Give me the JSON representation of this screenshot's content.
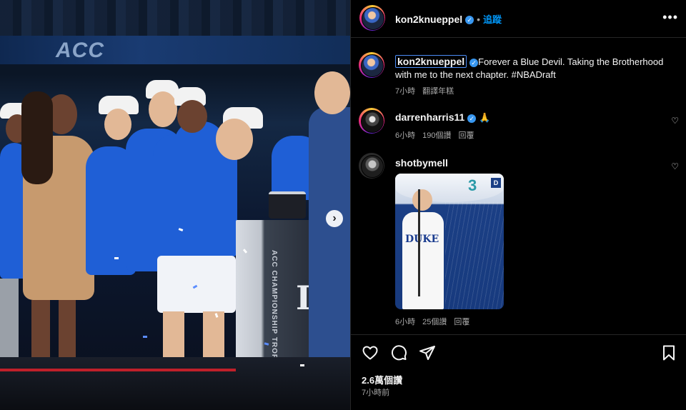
{
  "photo": {
    "banner_text": "ACC",
    "podium_text": "ACC CHAMPIONSHIP TROPHY",
    "podium_letter": "D",
    "next_arrow": "›"
  },
  "header": {
    "username": "kon2knueppel",
    "follow_label": "追蹤",
    "more_label": "•••"
  },
  "caption": {
    "username": "kon2knueppel",
    "text": "Forever a Blue Devil. Taking the Brotherhood with me to the next chapter. #NBADraft",
    "time": "7小時",
    "translate": "翻譯年糕"
  },
  "comments": [
    {
      "username": "darrenharris11",
      "text": "🙏",
      "time": "6小時",
      "likes": "190個讚",
      "reply": "回覆"
    },
    {
      "username": "shotbymell",
      "text": "",
      "time": "6小時",
      "likes": "25個讚",
      "reply": "回覆",
      "image": {
        "jersey_text": "DUKE",
        "corner_badge": "D",
        "number": "3"
      }
    }
  ],
  "footer": {
    "likes": "2.6萬個讚",
    "time": "7小時前"
  },
  "colors": {
    "background": "#000000",
    "link_blue": "#0095f6",
    "verified_blue": "#3897f0",
    "secondary_text": "#a8a8a8"
  },
  "icons": {
    "like": "heart-icon",
    "comment": "comment-icon",
    "share": "share-icon",
    "save": "bookmark-icon"
  }
}
